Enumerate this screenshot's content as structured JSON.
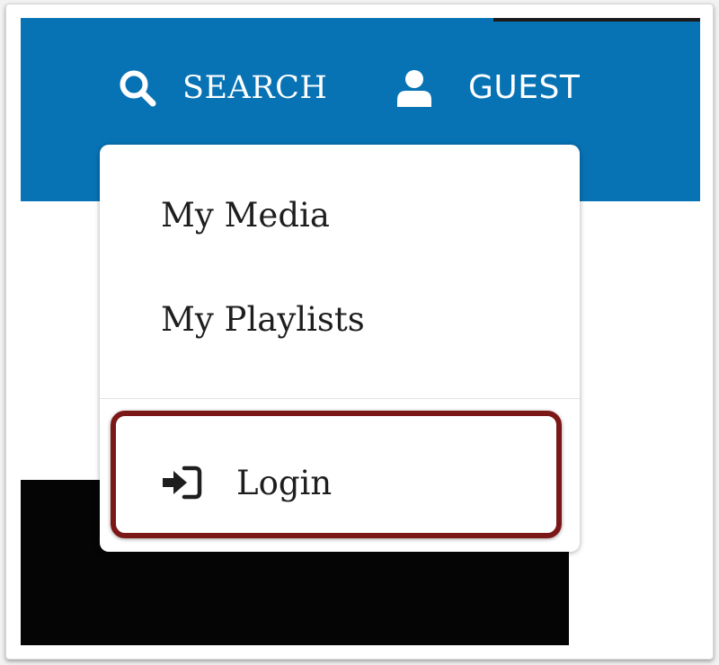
{
  "header": {
    "search_label": "SEARCH",
    "search_icon": "search-icon",
    "guest_label": "GUEST",
    "guest_icon": "user-icon",
    "bar_color": "#0773b5"
  },
  "user_menu": {
    "items": [
      {
        "label": "My Media"
      },
      {
        "label": "My Playlists"
      }
    ],
    "login": {
      "label": "Login",
      "icon": "sign-in-icon",
      "highlight_color": "#7b1716"
    }
  }
}
